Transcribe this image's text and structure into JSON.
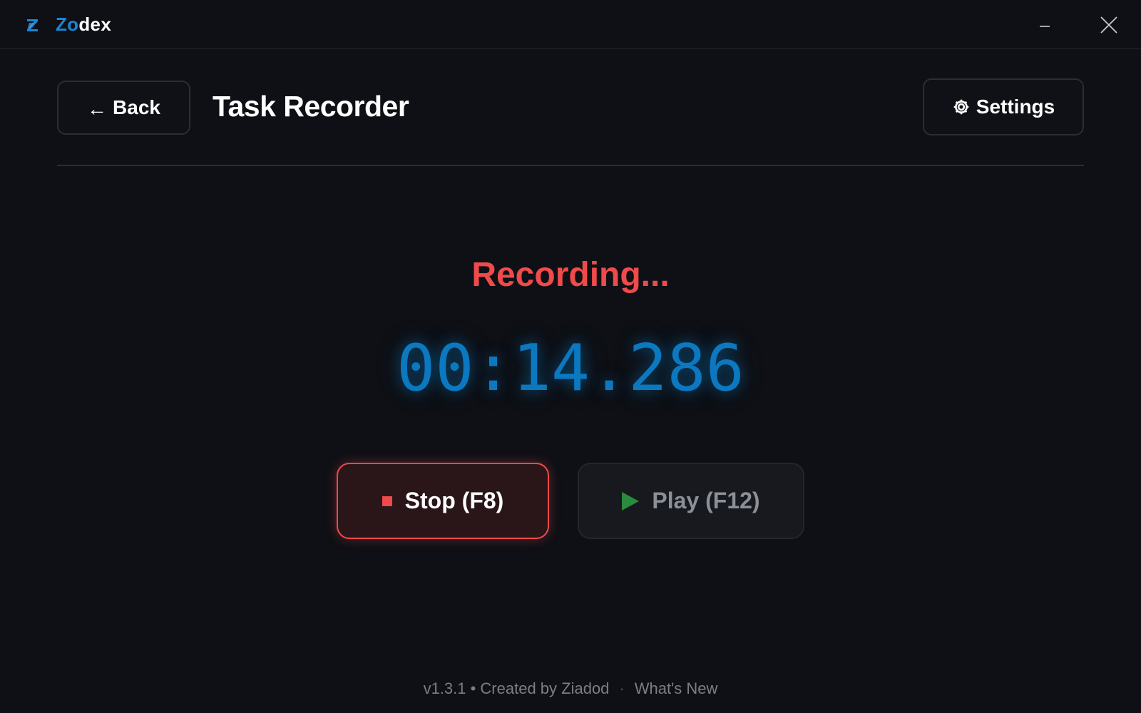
{
  "app": {
    "name_part1": "Zo",
    "name_part2": "dex",
    "logo_icon": "z-logo-icon",
    "brand_color": "#1a86d6"
  },
  "window_controls": {
    "minimize_icon": "minimize-icon",
    "close_icon": "close-icon"
  },
  "header": {
    "back_arrow": "←",
    "back_label": "Back",
    "title": "Task Recorder",
    "settings_icon": "gear-icon",
    "settings_label": "Settings"
  },
  "recorder": {
    "status": "Recording...",
    "status_color": "#f04a4a",
    "elapsed": "00:14.286",
    "timer_color": "#0b78c0"
  },
  "actions": {
    "stop_icon": "stop-square-icon",
    "stop_label": "Stop (F8)",
    "play_icon": "play-triangle-icon",
    "play_label": "Play (F12)"
  },
  "footer": {
    "version_credit": "v1.3.1 • Created by Ziadod",
    "separator": "·",
    "whats_new": "What's New"
  }
}
